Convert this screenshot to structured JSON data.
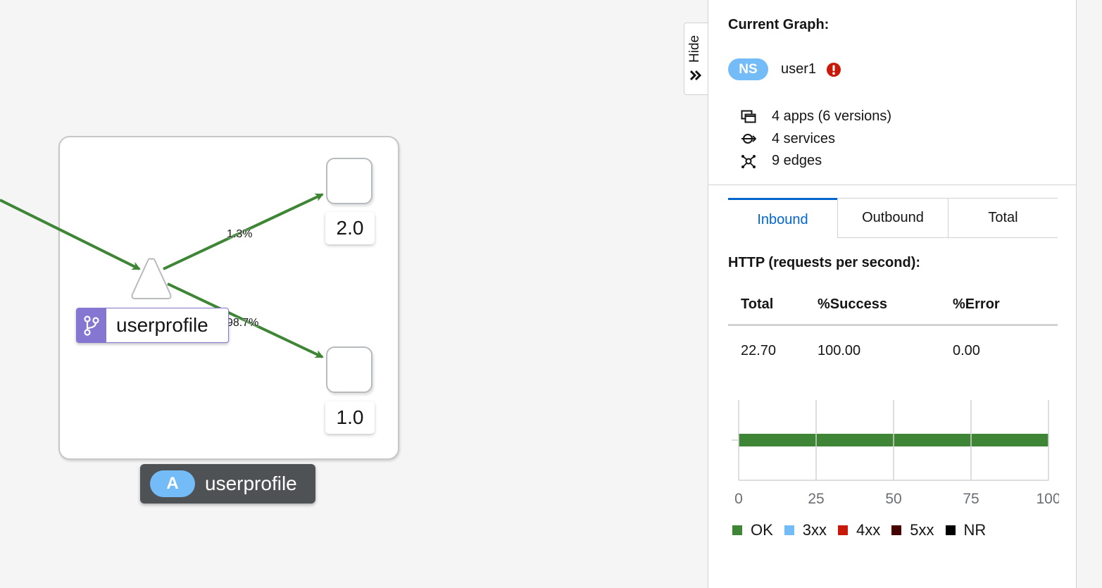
{
  "graph": {
    "service_node_label": "userprofile",
    "app_label": {
      "badge": "A",
      "name": "userprofile"
    },
    "versions": [
      {
        "label": "2.0",
        "edge_percent": "1.3%"
      },
      {
        "label": "1.0",
        "edge_percent": "98.7%"
      }
    ],
    "edge_color": "#3e8635"
  },
  "hide_tab": {
    "label": "Hide",
    "icon": "double-chevron-right-icon"
  },
  "panel": {
    "title": "Current Graph:",
    "namespace": {
      "badge": "NS",
      "name": "user1",
      "status_icon": "exclamation-circle-icon",
      "status_color": "#c9190b"
    },
    "stats": [
      {
        "icon": "applications-icon",
        "text": "4 apps (6 versions)"
      },
      {
        "icon": "services-icon",
        "text": "4 services"
      },
      {
        "icon": "topology-icon",
        "text": "9 edges"
      }
    ],
    "tabs": [
      {
        "label": "Inbound",
        "active": true
      },
      {
        "label": "Outbound",
        "active": false
      },
      {
        "label": "Total",
        "active": false
      }
    ],
    "http_title": "HTTP (requests per second):",
    "table": {
      "headers": [
        "Total",
        "%Success",
        "%Error"
      ],
      "row": [
        "22.70",
        "100.00",
        "0.00"
      ]
    },
    "legend": [
      {
        "label": "OK",
        "color": "#3e8635"
      },
      {
        "label": "3xx",
        "color": "#73bcf7"
      },
      {
        "label": "4xx",
        "color": "#c9190b"
      },
      {
        "label": "5xx",
        "color": "#470000"
      },
      {
        "label": "NR",
        "color": "#000000"
      }
    ]
  },
  "chart_data": {
    "type": "bar",
    "orientation": "horizontal",
    "series": [
      {
        "name": "OK",
        "values": [
          100
        ]
      },
      {
        "name": "3xx",
        "values": [
          0
        ]
      },
      {
        "name": "4xx",
        "values": [
          0
        ]
      },
      {
        "name": "5xx",
        "values": [
          0
        ]
      },
      {
        "name": "NR",
        "values": [
          0
        ]
      }
    ],
    "xlim": [
      0,
      100
    ],
    "xticks": [
      "0",
      "25",
      "50",
      "75",
      "100"
    ],
    "grid": true,
    "legend_position": "bottom"
  }
}
